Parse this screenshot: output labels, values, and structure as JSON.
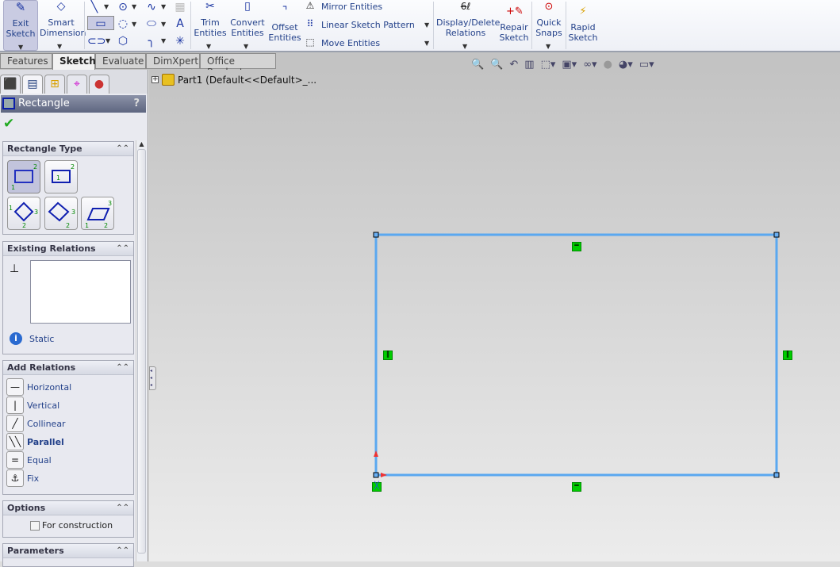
{
  "toolbar": {
    "exit_sketch": "Exit\nSketch",
    "smart_dimension": "Smart\nDimension",
    "trim_entities": "Trim\nEntities",
    "convert_entities": "Convert\nEntities",
    "offset_entities": "Offset\nEntities",
    "mirror_entities": "Mirror Entities",
    "linear_sketch_pattern": "Linear Sketch Pattern",
    "move_entities": "Move Entities",
    "display_delete_relations": "Display/Delete\nRelations",
    "repair_sketch": "Repair\nSketch",
    "quick_snaps": "Quick\nSnaps",
    "rapid_sketch": "Rapid\nSketch"
  },
  "tabs": [
    {
      "label": "Features"
    },
    {
      "label": "Sketch",
      "active": true
    },
    {
      "label": "Evaluate"
    },
    {
      "label": "DimXpert"
    },
    {
      "label": "Office Products"
    }
  ],
  "tree": {
    "root": "Part1  (Default<<Default>_..."
  },
  "property_manager": {
    "title": "Rectangle",
    "help": "?",
    "rectangle_type": {
      "label": "Rectangle Type",
      "selected": "corner-rectangle"
    },
    "existing_relations": {
      "label": "Existing Relations",
      "status": "Static"
    },
    "add_relations": {
      "label": "Add Relations",
      "items": [
        {
          "label": "Horizontal",
          "icon": "—"
        },
        {
          "label": "Vertical",
          "icon": "|"
        },
        {
          "label": "Collinear",
          "icon": "╱"
        },
        {
          "label": "Parallel",
          "icon": "╲╲",
          "bold": true
        },
        {
          "label": "Equal",
          "icon": "="
        },
        {
          "label": "Fix",
          "icon": "⚓"
        }
      ]
    },
    "options": {
      "label": "Options",
      "for_construction": "For construction",
      "for_construction_checked": false
    },
    "parameters": {
      "label": "Parameters"
    }
  },
  "colors": {
    "sketch_line": "#5aa8f0",
    "relation_marker": "#00cc00",
    "accent": "#23418a"
  }
}
